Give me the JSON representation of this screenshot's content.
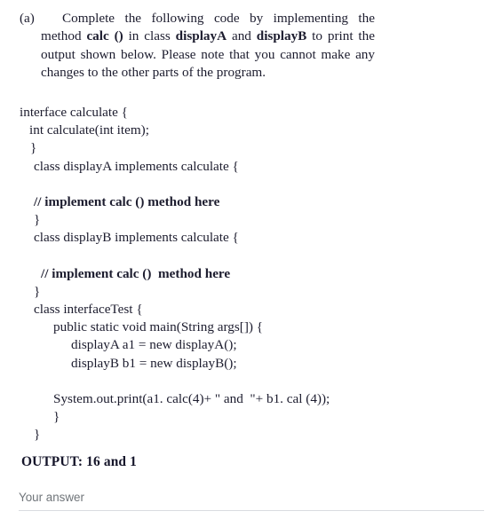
{
  "question": {
    "label": "(a)",
    "prompt_runs": [
      {
        "text": "Complete the following code by implementing the method ",
        "bold": false
      },
      {
        "text": "calc ()",
        "bold": true
      },
      {
        "text": " in class ",
        "bold": false
      },
      {
        "text": "displayA",
        "bold": true
      },
      {
        "text": " and ",
        "bold": false
      },
      {
        "text": "displayB",
        "bold": true
      },
      {
        "text": " to print the output shown below. Please note that you cannot make any changes to the other parts of the program.",
        "bold": false
      }
    ],
    "prompt_plain": "Complete the following code by implementing the method calc () in class displayA and displayB to print the output shown below. Please note that you cannot make any changes to the other parts of the program."
  },
  "code": {
    "language": "java",
    "lines": [
      {
        "indent": 0,
        "text": "interface calculate {",
        "bold": false
      },
      {
        "indent": 11,
        "text": "int calculate(int item);",
        "bold": false
      },
      {
        "indent": 12,
        "text": "}",
        "bold": false
      },
      {
        "indent": 16,
        "text": "class displayA implements calculate {",
        "bold": false
      },
      {
        "indent": 0,
        "text": "",
        "bold": false
      },
      {
        "indent": 16,
        "text": "// implement calc () method here",
        "bold": true
      },
      {
        "indent": 16,
        "text": "}",
        "bold": false
      },
      {
        "indent": 16,
        "text": "class displayB implements calculate {",
        "bold": false
      },
      {
        "indent": 0,
        "text": "",
        "bold": false
      },
      {
        "indent": 24,
        "text": "// implement calc ()  method here",
        "bold": true
      },
      {
        "indent": 16,
        "text": "}",
        "bold": false
      },
      {
        "indent": 16,
        "text": "class interfaceTest {",
        "bold": false
      },
      {
        "indent": 38,
        "text": "public static void main(String args[]) {",
        "bold": false
      },
      {
        "indent": 58,
        "text": "displayA a1 = new displayA();",
        "bold": false
      },
      {
        "indent": 58,
        "text": "displayB b1 = new displayB();",
        "bold": false
      },
      {
        "indent": 0,
        "text": "",
        "bold": false
      },
      {
        "indent": 38,
        "text": "System.out.print(a1. calc(4)+ \" and  \"+ b1. cal (4));",
        "bold": false
      },
      {
        "indent": 38,
        "text": "}",
        "bold": false
      },
      {
        "indent": 16,
        "text": "}",
        "bold": false
      }
    ]
  },
  "output": {
    "text": "OUTPUT: 16  and 1"
  },
  "answer": {
    "value": "",
    "placeholder": "Your answer"
  },
  "colors": {
    "text": "#1c1c2e",
    "placeholder": "#70757a",
    "underline": "#dadce0",
    "background": "#ffffff"
  }
}
